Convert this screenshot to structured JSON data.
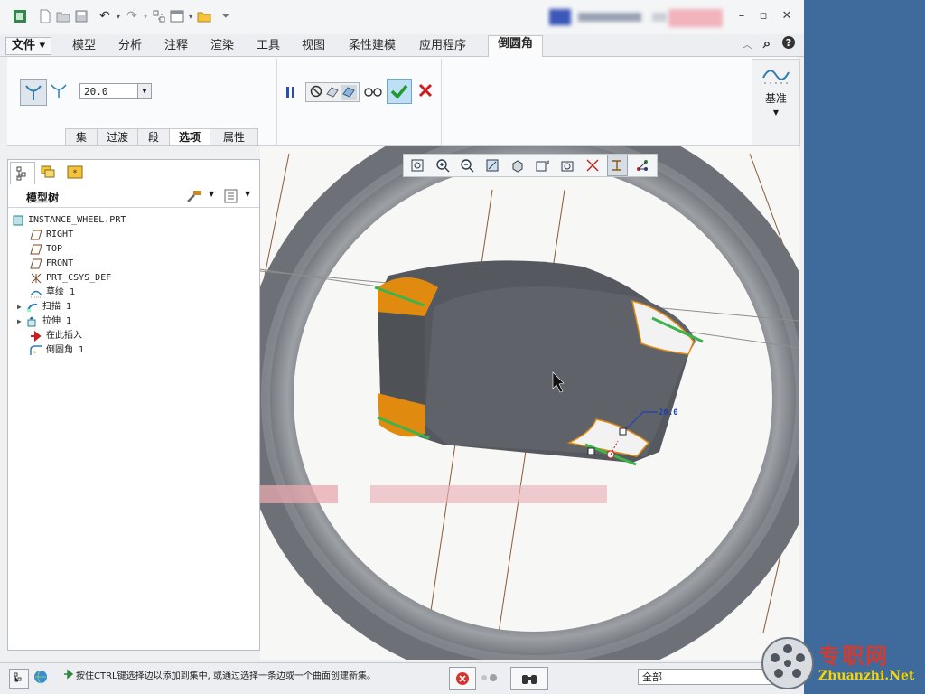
{
  "quick_access": {
    "icons": [
      "app-icon",
      "new-icon",
      "open-icon",
      "save-icon",
      "undo-icon",
      "redo-icon",
      "regenerate-icon",
      "windows-icon",
      "folder-icon",
      "customize-icon"
    ]
  },
  "tabs": {
    "file": "文件 ▾",
    "items": [
      "模型",
      "分析",
      "注释",
      "渲染",
      "工具",
      "视图",
      "柔性建模",
      "应用程序"
    ],
    "active": "倒圆角"
  },
  "ribbon": {
    "radius_value": "20.0",
    "subtabs": [
      "集",
      "过渡",
      "段",
      "选项",
      "属性"
    ],
    "active_subtab": "选项",
    "datum_label": "基准"
  },
  "model_tree": {
    "title": "模型树",
    "items": [
      {
        "label": "INSTANCE_WHEEL.PRT",
        "icon": "part-icon"
      },
      {
        "label": "RIGHT",
        "icon": "datum-plane-icon"
      },
      {
        "label": "TOP",
        "icon": "datum-plane-icon"
      },
      {
        "label": "FRONT",
        "icon": "datum-plane-icon"
      },
      {
        "label": "PRT_CSYS_DEF",
        "icon": "csys-icon"
      },
      {
        "label": "草绘 1",
        "icon": "sketch-icon"
      },
      {
        "label": "扫描 1",
        "icon": "sweep-icon"
      },
      {
        "label": "拉伸 1",
        "icon": "extrude-icon"
      },
      {
        "label": "在此插入",
        "icon": "insert-arrow-icon"
      },
      {
        "label": "倒圆角 1",
        "icon": "round-icon"
      }
    ]
  },
  "viewport": {
    "dimension_label": "20.0"
  },
  "status_bar": {
    "message": "按住CTRL键选择边以添加到集中, 或通过选择一条边或一个曲面创建新集。",
    "filter_value": "全部"
  },
  "watermark": {
    "cn": "专职网",
    "en": "Zhuanzhi.Net"
  },
  "colors": {
    "accent_orange": "#e08a10",
    "highlight_green": "#3cb44b",
    "ok_green": "#1e9a2e",
    "cancel_red": "#d11a1a",
    "desktop_blue": "#3e6b9b"
  }
}
